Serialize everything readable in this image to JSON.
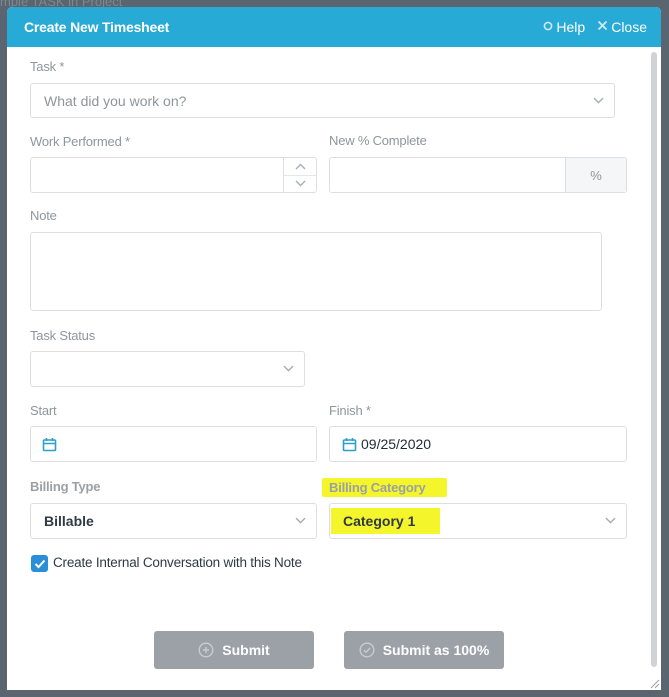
{
  "background": {
    "breadcrumb_text": "mple TASK in Project"
  },
  "header": {
    "title": "Create New Timesheet",
    "help_label": "Help",
    "close_label": "Close"
  },
  "form": {
    "task": {
      "label": "Task *",
      "placeholder": "What did you work on?"
    },
    "work_performed": {
      "label": "Work Performed *",
      "value": ""
    },
    "percent_complete": {
      "label": "New % Complete",
      "value": "",
      "addon": "%"
    },
    "note": {
      "label": "Note",
      "value": ""
    },
    "task_status": {
      "label": "Task Status",
      "value": ""
    },
    "start": {
      "label": "Start",
      "value": ""
    },
    "finish": {
      "label": "Finish *",
      "value": "09/25/2020"
    },
    "billing_type": {
      "label": "Billing Type",
      "value": "Billable"
    },
    "billing_category": {
      "label": "Billing Category",
      "value": "Category 1",
      "highlight_color": "#f5f52c"
    },
    "internal_conversation": {
      "label": "Create Internal Conversation with this Note",
      "checked": true
    }
  },
  "buttons": {
    "submit": "Submit",
    "submit_100": "Submit as 100%"
  },
  "colors": {
    "header": "#27aad5",
    "button_disabled": "#9ca1a8",
    "checkbox": "#2a8fd6"
  }
}
